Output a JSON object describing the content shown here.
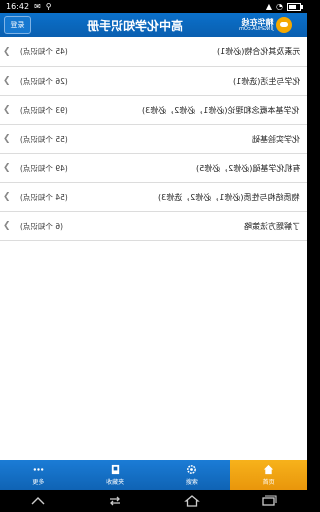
{
  "status": {
    "time": "16:42"
  },
  "header": {
    "login": "登录",
    "title": "高中化学知识手册",
    "logo_cn": "精华在线",
    "logo_en": "JINGHUA.cOm"
  },
  "items": [
    {
      "name": "元素及其化合物(必修1)",
      "count": "(45 个知识点)"
    },
    {
      "name": "化学与生活(选修1)",
      "count": "(26 个知识点)"
    },
    {
      "name": "化学基本概念和理论(必修1，必修2，必修3)",
      "count": "(93 个知识点)"
    },
    {
      "name": "化学实验基础",
      "count": "(55 个知识点)"
    },
    {
      "name": "有机化学基础(必修2，必修5)",
      "count": "(49 个知识点)"
    },
    {
      "name": "物质结构与性质(必修1，必修2，选修3)",
      "count": "(54 个知识点)"
    },
    {
      "name": "了解题方法策略",
      "count": "(6 个知识点)"
    }
  ],
  "tabs": [
    {
      "label": "更多",
      "icon": "more-icon"
    },
    {
      "label": "收藏夹",
      "icon": "bookmark-icon"
    },
    {
      "label": "搜索",
      "icon": "gear-icon"
    },
    {
      "label": "首页",
      "icon": "home-icon"
    }
  ]
}
